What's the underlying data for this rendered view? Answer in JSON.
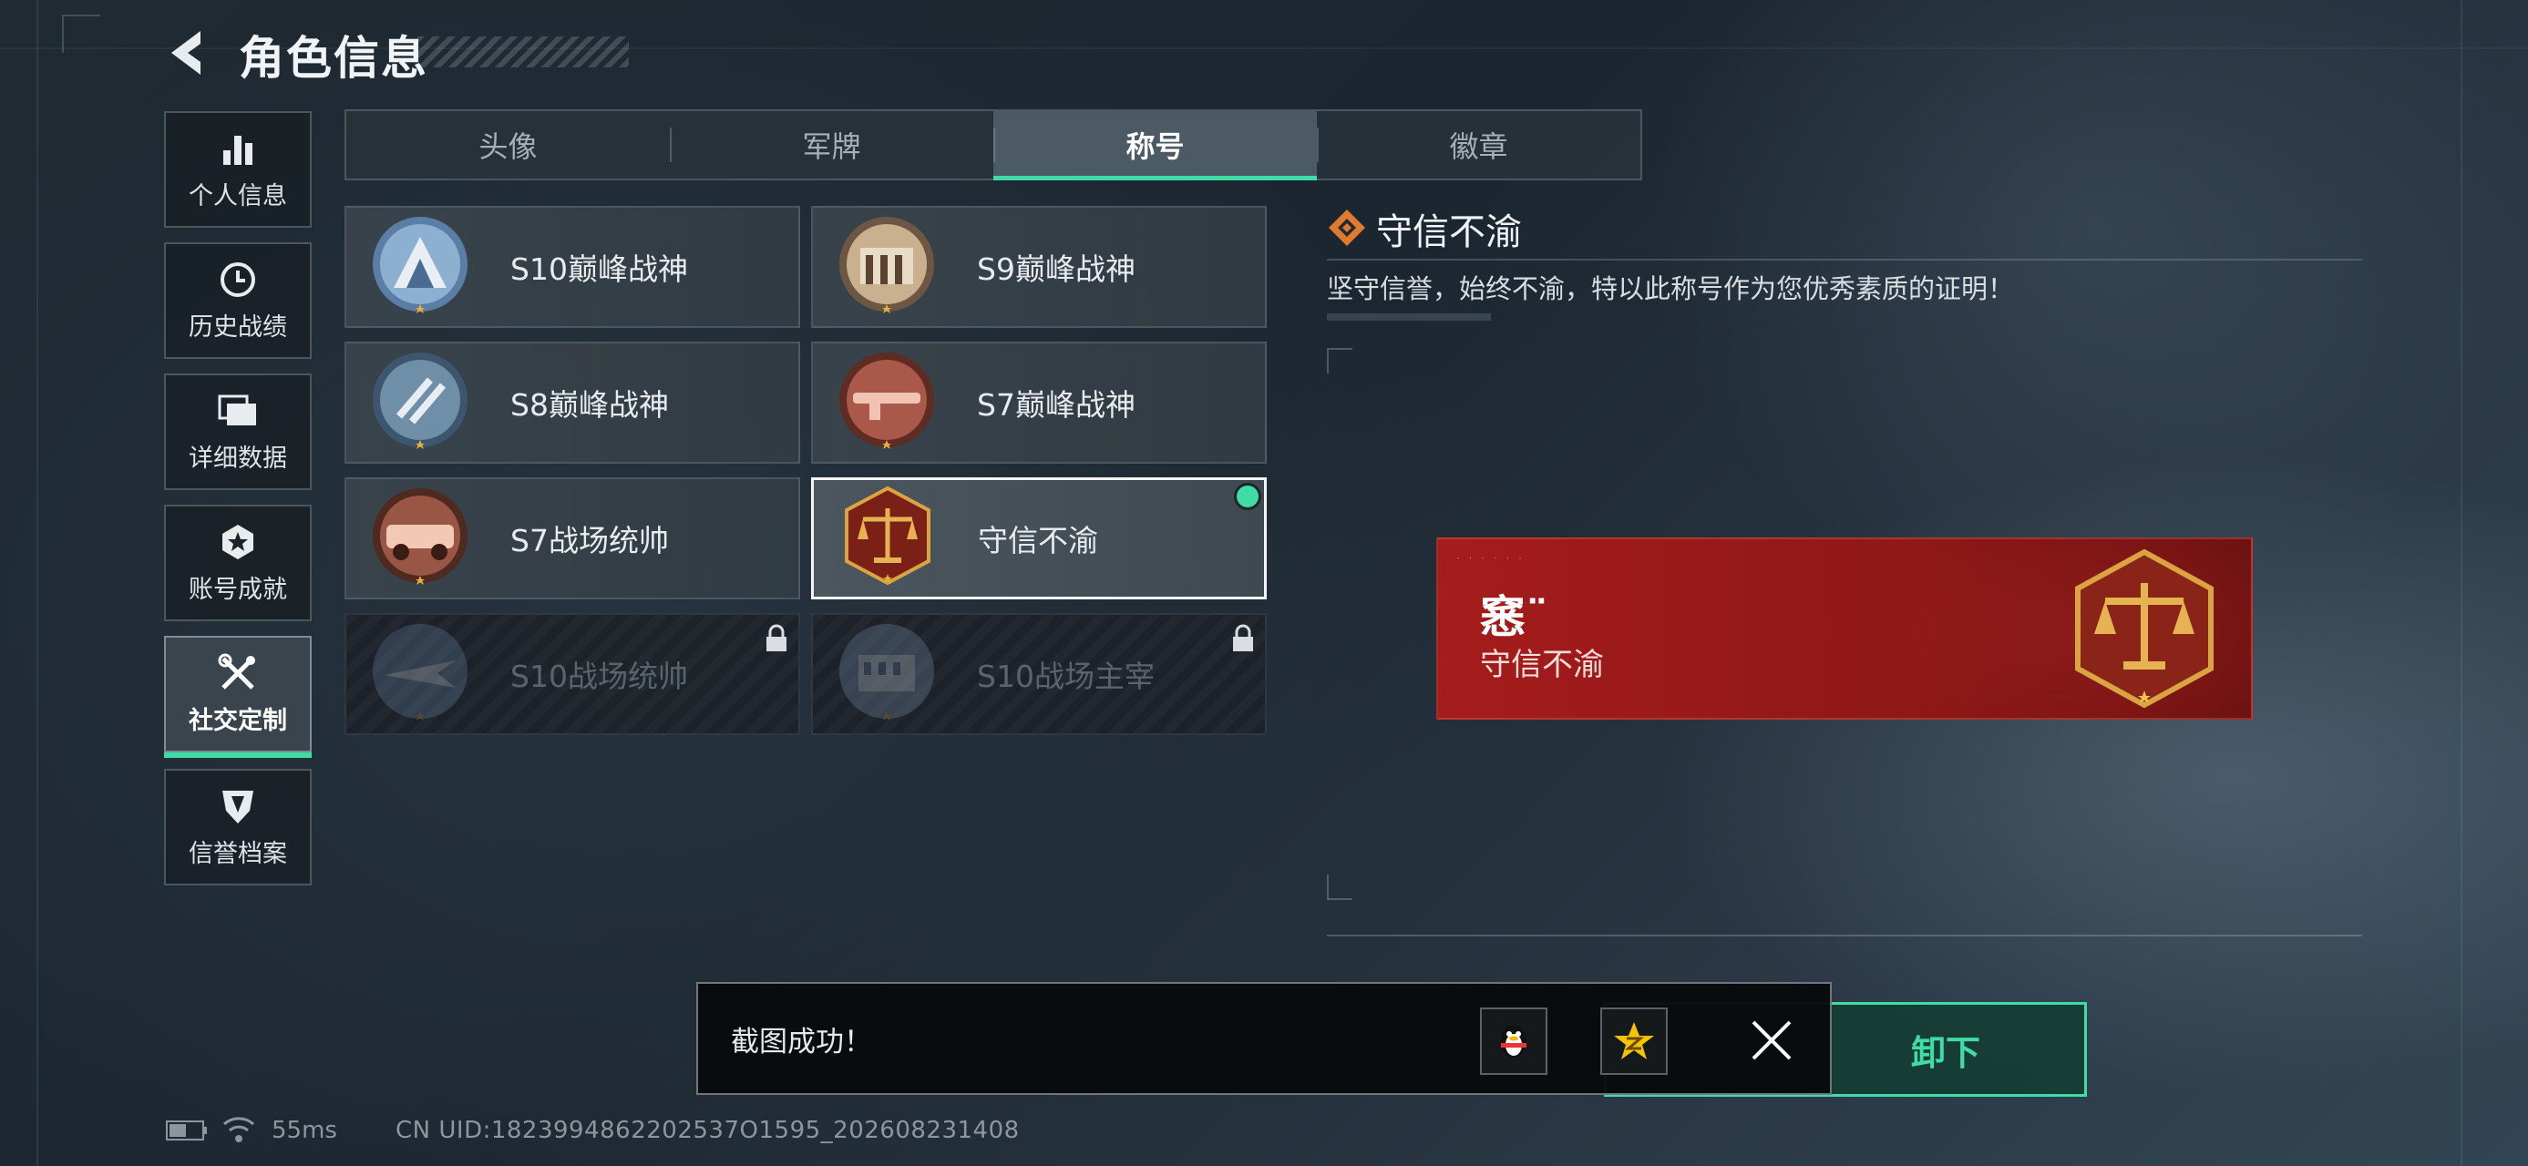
{
  "header": {
    "title": "角色信息"
  },
  "sidebar": {
    "items": [
      {
        "label": "个人信息",
        "icon": "bar-chart-icon"
      },
      {
        "label": "历史战绩",
        "icon": "clock-history-icon"
      },
      {
        "label": "详细数据",
        "icon": "folder-icon"
      },
      {
        "label": "账号成就",
        "icon": "achievement-star-icon"
      },
      {
        "label": "社交定制",
        "icon": "wrench-tools-icon",
        "active": true
      },
      {
        "label": "信誉档案",
        "icon": "shield-emblem-icon"
      }
    ]
  },
  "tabs": [
    {
      "label": "头像"
    },
    {
      "label": "军牌"
    },
    {
      "label": "称号",
      "active": true
    },
    {
      "label": "徽章"
    }
  ],
  "titles": [
    {
      "label": "S10巅峰战神",
      "icon": "blue-peak-medal-icon"
    },
    {
      "label": "S9巅峰战神",
      "icon": "bronze-fortress-medal-icon"
    },
    {
      "label": "S8巅峰战神",
      "icon": "blue-stripes-medal-icon"
    },
    {
      "label": "S7巅峰战神",
      "icon": "copper-rifle-medal-icon"
    },
    {
      "label": "S7战场统帅",
      "icon": "copper-vehicle-medal-icon"
    },
    {
      "label": "守信不渝",
      "icon": "justice-scales-medal-icon",
      "selected": true,
      "equipped": true
    },
    {
      "label": "S10战场统帅",
      "icon": "aircraft-medal-icon",
      "locked": true
    },
    {
      "label": "S10战场主宰",
      "icon": "colosseum-medal-icon",
      "locked": true
    }
  ],
  "detail": {
    "title": "守信不渝",
    "description": "坚守信誉，始终不渝，特以此称号作为您优秀素质的证明！"
  },
  "banner": {
    "player_name": "窸¨",
    "title": "守信不渝",
    "colors": {
      "primary": "#a51c1c",
      "accent": "#d9a441"
    }
  },
  "actions": {
    "unequip_label": "卸下"
  },
  "toast": {
    "message": "截图成功！",
    "share_targets": [
      "qq-penguin-icon",
      "qzone-star-icon"
    ]
  },
  "status": {
    "ping": "55ms",
    "uid": "CN UID:1823994862202537O1595_202608231408"
  },
  "colors": {
    "accent_green": "#3fdca6",
    "background": "#1f2a33"
  }
}
